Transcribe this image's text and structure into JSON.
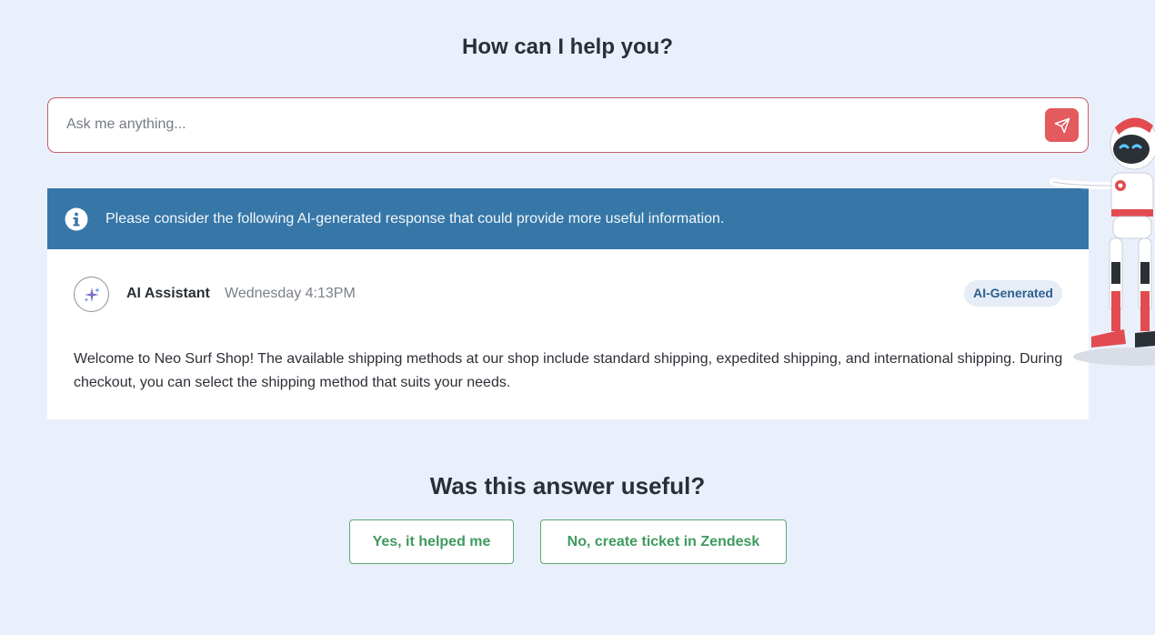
{
  "header": {
    "title": "How can I help you?"
  },
  "search": {
    "placeholder": "Ask me anything...",
    "value": ""
  },
  "banner": {
    "text": "Please consider the following AI-generated response that could provide more useful information."
  },
  "response": {
    "author": "AI Assistant",
    "timestamp": "Wednesday 4:13PM",
    "badge": "AI-Generated",
    "message": "Welcome to Neo Surf Shop! The available shipping methods at our shop include standard shipping, expedited shipping, and international shipping. During checkout, you can select the shipping method that suits your needs."
  },
  "feedback": {
    "title": "Was this answer useful?",
    "yes_label": "Yes, it helped me",
    "no_label": "No, create ticket in Zendesk"
  },
  "colors": {
    "background": "#eaf0fb",
    "accent_red": "#e35a5f",
    "banner_blue": "#3677a8",
    "success_green": "#3f9a5f"
  },
  "icons": {
    "send": "send-icon",
    "info": "info-icon",
    "assistant": "sparkle-icon",
    "mascot": "robot-mascot"
  }
}
